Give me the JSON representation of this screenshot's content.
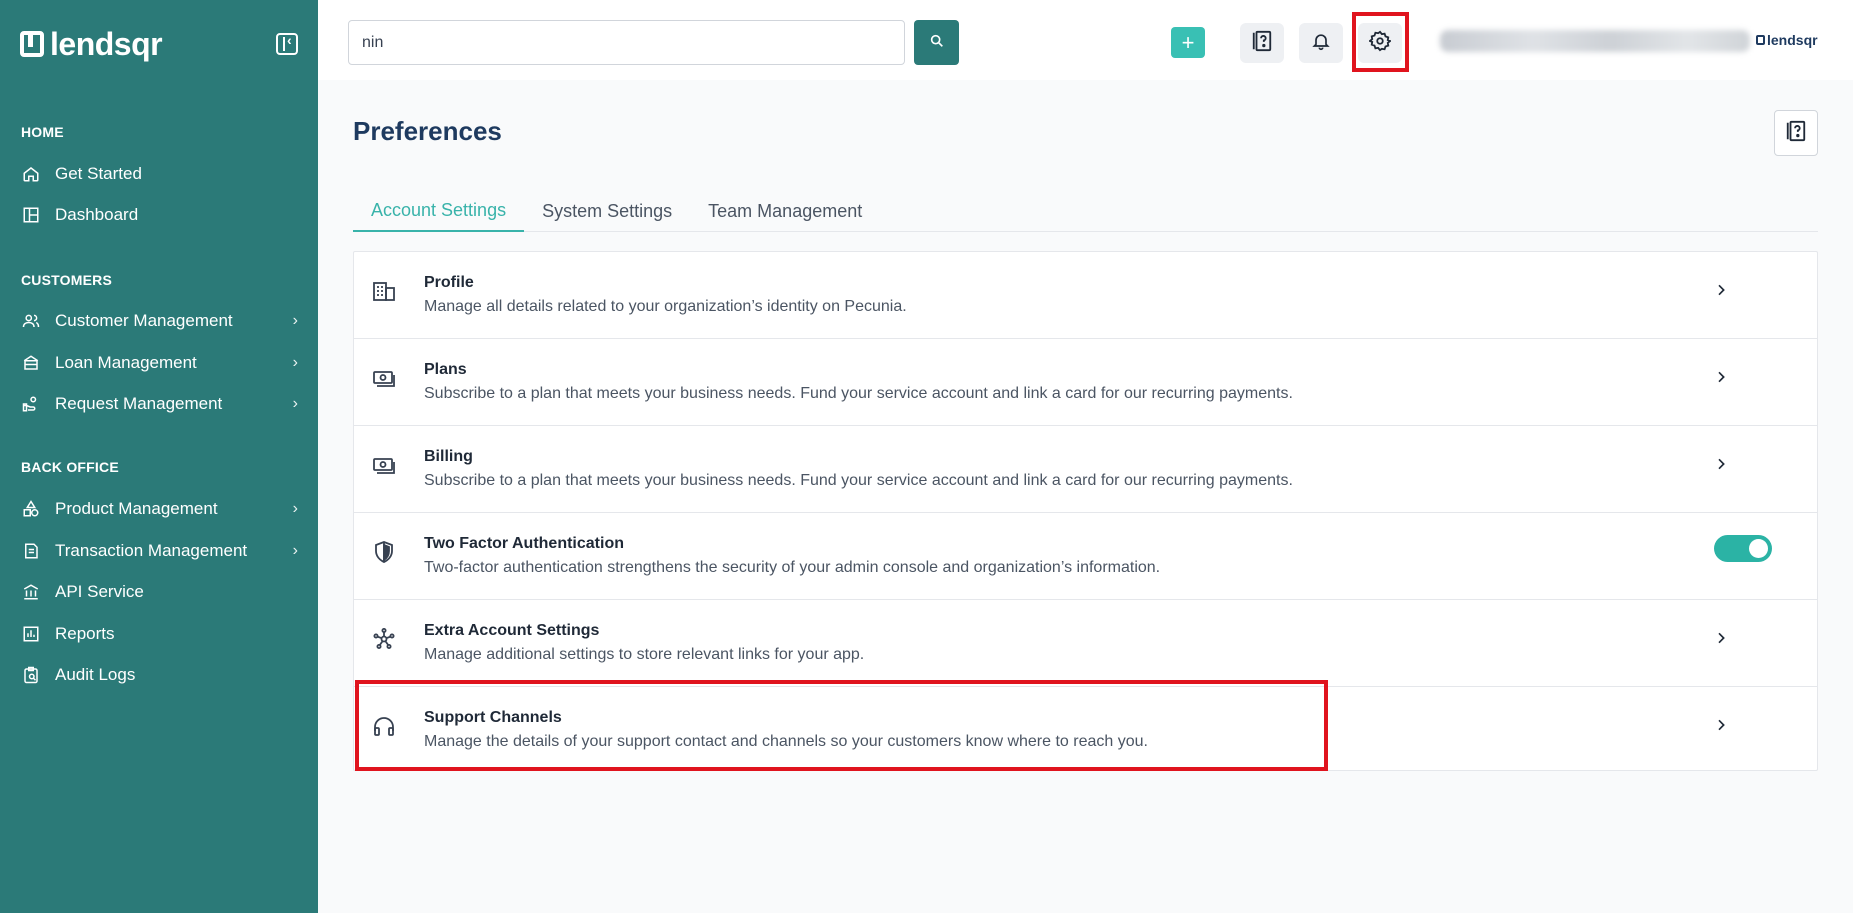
{
  "brand": {
    "name": "lendsqr"
  },
  "sidebar": {
    "sections": [
      {
        "title": "HOME",
        "items": [
          {
            "label": "Get Started",
            "icon": "home-icon"
          },
          {
            "label": "Dashboard",
            "icon": "dashboard-icon"
          }
        ]
      },
      {
        "title": "CUSTOMERS",
        "items": [
          {
            "label": "Customer Management",
            "icon": "users-icon"
          },
          {
            "label": "Loan Management",
            "icon": "bank-icon"
          },
          {
            "label": "Request Management",
            "icon": "hand-coin-icon"
          }
        ]
      },
      {
        "title": "BACK OFFICE",
        "items": [
          {
            "label": "Product Management",
            "icon": "shapes-icon"
          },
          {
            "label": "Transaction Management",
            "icon": "transaction-icon"
          },
          {
            "label": "API Service",
            "icon": "building-icon"
          },
          {
            "label": "Reports",
            "icon": "chart-icon"
          },
          {
            "label": "Audit Logs",
            "icon": "clipboard-icon"
          }
        ]
      }
    ]
  },
  "search": {
    "value": "nin",
    "placeholder": ""
  },
  "page": {
    "title": "Preferences"
  },
  "tabs": [
    {
      "label": "Account Settings",
      "active": true
    },
    {
      "label": "System Settings",
      "active": false
    },
    {
      "label": "Team Management",
      "active": false
    }
  ],
  "settings": [
    {
      "title": "Profile",
      "description": "Manage all details related to your organization’s identity on Pecunia.",
      "icon": "building-icon"
    },
    {
      "title": "Plans",
      "description": "Subscribe to a plan that meets your business needs. Fund your service account and link a card for our recurring payments.",
      "icon": "cash-icon"
    },
    {
      "title": "Billing",
      "description": "Subscribe to a plan that meets your business needs. Fund your service account and link a card for our recurring payments.",
      "icon": "cash-icon"
    },
    {
      "title": "Two Factor Authentication",
      "description": "Two-factor authentication strengthens the security of your admin console and organization’s information.",
      "icon": "shield-icon",
      "toggle_on": true
    },
    {
      "title": "Extra Account Settings",
      "description": "Manage additional settings to store relevant links for your app.",
      "icon": "network-icon"
    },
    {
      "title": "Support Channels",
      "description": "Manage the details of your support contact and channels so your customers know where to reach you.",
      "icon": "headphones-icon"
    }
  ],
  "colors": {
    "sidebar": "#2b7a78",
    "accent": "#39b3aa",
    "highlight": "#e0141e",
    "title": "#1e3a5f"
  }
}
